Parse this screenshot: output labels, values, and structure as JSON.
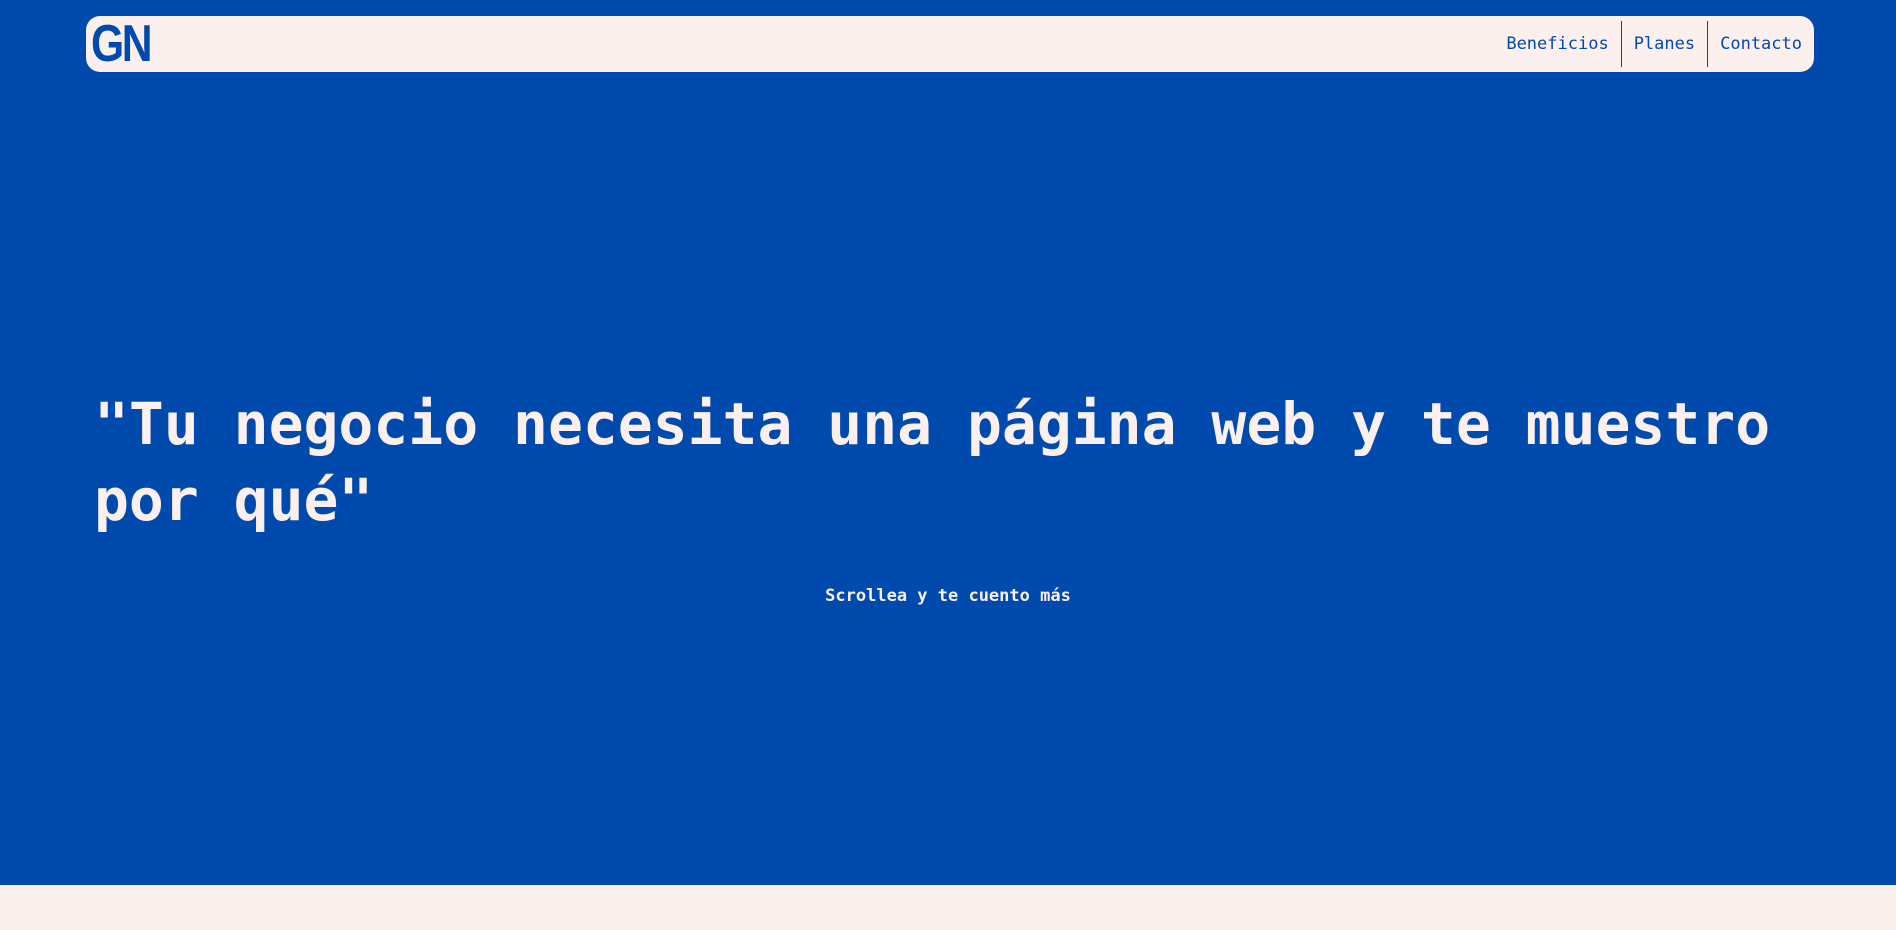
{
  "brand": {
    "logo_text": "GN"
  },
  "nav": {
    "items": [
      {
        "label": "Beneficios"
      },
      {
        "label": "Planes"
      },
      {
        "label": "Contacto"
      }
    ]
  },
  "hero": {
    "headline": "\"Tu negocio necesita una página web y te muestro por qué\"",
    "scroll_hint": "Scrollea y te cuento más"
  },
  "colors": {
    "primary_blue": "#0049ad",
    "cream": "#fbf0ee"
  }
}
